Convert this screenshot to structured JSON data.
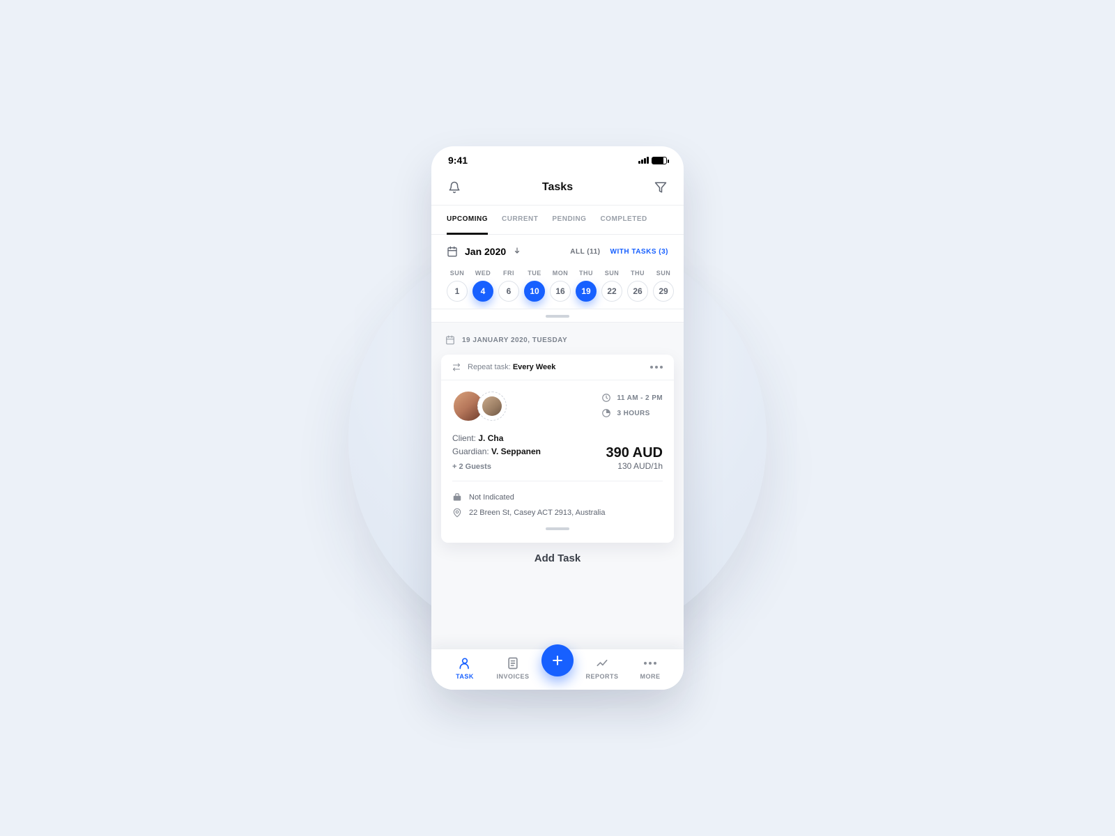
{
  "status": {
    "time": "9:41"
  },
  "header": {
    "title": "Tasks"
  },
  "tabs": [
    {
      "label": "UPCOMING",
      "active": true
    },
    {
      "label": "CURRENT",
      "active": false
    },
    {
      "label": "PENDING",
      "active": false
    },
    {
      "label": "COMPLETED",
      "active": false
    }
  ],
  "month": {
    "label": "Jan 2020",
    "filter_all": "ALL (11)",
    "filter_with": "WITH TASKS (3)"
  },
  "dates": [
    {
      "dow": "SUN",
      "num": "1",
      "active": false
    },
    {
      "dow": "WED",
      "num": "4",
      "active": true
    },
    {
      "dow": "FRI",
      "num": "6",
      "active": false
    },
    {
      "dow": "TUE",
      "num": "10",
      "active": true
    },
    {
      "dow": "MON",
      "num": "16",
      "active": false
    },
    {
      "dow": "THU",
      "num": "19",
      "active": true
    },
    {
      "dow": "SUN",
      "num": "22",
      "active": false
    },
    {
      "dow": "THU",
      "num": "26",
      "active": false
    },
    {
      "dow": "SUN",
      "num": "29",
      "active": false
    }
  ],
  "selected_date_header": "19 JANUARY 2020, TUESDAY",
  "card": {
    "repeat_prefix": "Repeat task: ",
    "repeat_value": "Every Week",
    "time_range": "11 AM - 2 PM",
    "duration": "3 HOURS",
    "client_label": "Client: ",
    "client_name": "J. Cha",
    "guardian_label": "Guardian: ",
    "guardian_name": "V. Seppanen",
    "guests": "+ 2 Guests",
    "price_total": "390 AUD",
    "price_rate": "130 AUD/1h",
    "status": "Not Indicated",
    "address": "22 Breen St, Casey ACT 2913, Australia"
  },
  "add_task_label": "Add Task",
  "nav": [
    {
      "label": "TASK",
      "active": true
    },
    {
      "label": "INVOICES",
      "active": false
    },
    {
      "label": "REPORTS",
      "active": false
    },
    {
      "label": "MORE",
      "active": false
    }
  ]
}
